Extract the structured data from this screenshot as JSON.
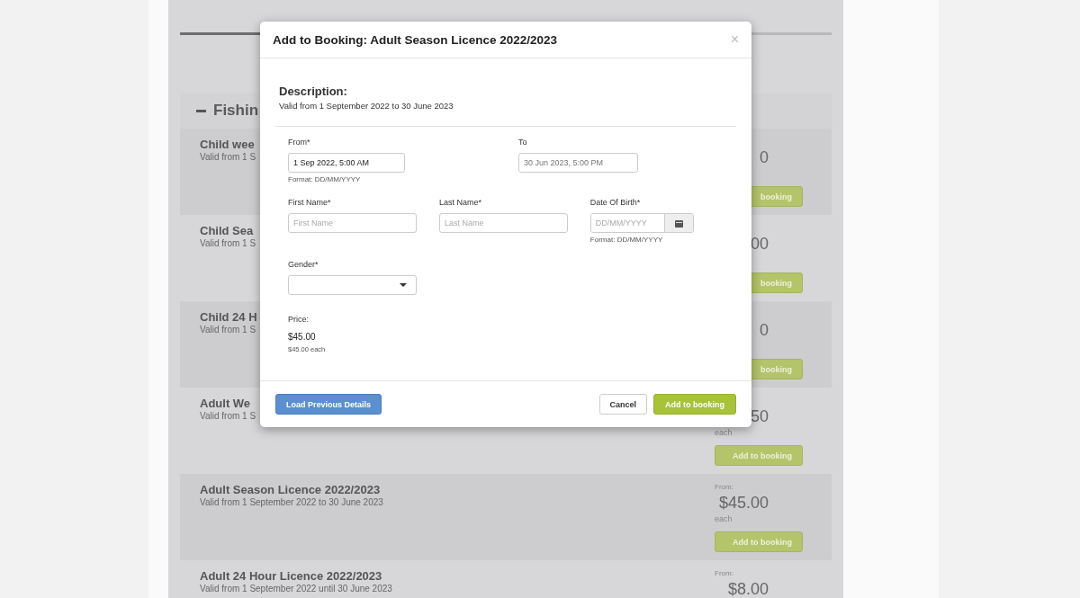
{
  "section": {
    "title": "Fishin",
    "expanded": true
  },
  "rows": [
    {
      "title": "Child wee",
      "subtitle": "Valid from 1 S",
      "price": "0",
      "button": "booking"
    },
    {
      "title": "Child Sea",
      "subtitle": "Valid from 1 S",
      "price": "00",
      "button": "booking"
    },
    {
      "title": "Child 24 H",
      "subtitle": "Valid from 1 S",
      "price": "0",
      "button": "booking"
    },
    {
      "title": "Adult We",
      "subtitle": "Valid from 1 S",
      "price": "50",
      "each": "each",
      "button": "Add to booking"
    },
    {
      "title": "Adult Season Licence 2022/2023",
      "subtitle": "Valid from 1 September 2022 to 30 June 2023",
      "from": "From:",
      "price": "$45.00",
      "each": "each",
      "button": "Add to booking"
    },
    {
      "title": "Adult 24 Hour Licence 2022/2023",
      "subtitle": "Valid from 1 September 2022 until 30 June 2023",
      "from": "From:",
      "price": "$8.00"
    }
  ],
  "modal": {
    "title": "Add to Booking: Adult Season Licence 2022/2023",
    "close": "×",
    "description_label": "Description:",
    "description": "Valid from 1 September 2022 to 30 June 2023",
    "from": {
      "label": "From*",
      "value": "1 Sep 2022, 5:00 AM",
      "hint": "Format: DD/MM/YYYY"
    },
    "to": {
      "label": "To",
      "value": "30 Jun 2023, 5:00 PM"
    },
    "first_name": {
      "label": "First Name*",
      "placeholder": "First Name"
    },
    "last_name": {
      "label": "Last Name*",
      "placeholder": "Last Name"
    },
    "date_of_birth": {
      "label": "Date Of Birth*",
      "placeholder": "DD/MM/YYYY",
      "hint": "Format: DD/MM/YYYY"
    },
    "gender": {
      "label": "Gender*"
    },
    "price": {
      "label": "Price:",
      "amount": "$45.00",
      "each": "$45.00 each"
    },
    "buttons": {
      "load": "Load Previous Details",
      "cancel": "Cancel",
      "add": "Add to booking"
    }
  }
}
